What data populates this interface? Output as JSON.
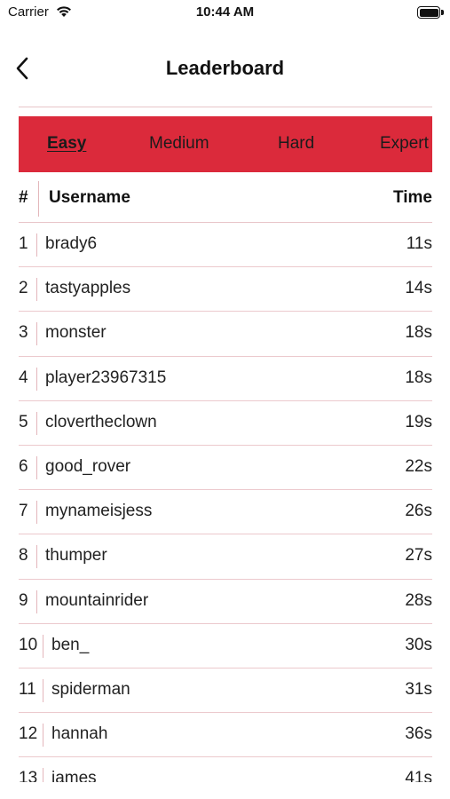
{
  "status_bar": {
    "carrier": "Carrier",
    "time": "10:44 AM"
  },
  "nav": {
    "title": "Leaderboard",
    "back_icon": "chevron-left-icon"
  },
  "tabs": [
    {
      "label": "Easy",
      "active": true
    },
    {
      "label": "Medium",
      "active": false
    },
    {
      "label": "Hard",
      "active": false
    },
    {
      "label": "Expert",
      "active": false
    }
  ],
  "colors": {
    "accent": "#db2a3b",
    "divider": "#e8c5c9"
  },
  "table": {
    "headers": {
      "rank": "#",
      "username": "Username",
      "time": "Time"
    },
    "rows": [
      {
        "rank": "1",
        "username": "brady6",
        "time": "11s"
      },
      {
        "rank": "2",
        "username": "tastyapples",
        "time": "14s"
      },
      {
        "rank": "3",
        "username": "monster",
        "time": "18s"
      },
      {
        "rank": "4",
        "username": "player23967315",
        "time": "18s"
      },
      {
        "rank": "5",
        "username": "clovertheclown",
        "time": "19s"
      },
      {
        "rank": "6",
        "username": "good_rover",
        "time": "22s"
      },
      {
        "rank": "7",
        "username": "mynameisjess",
        "time": "26s"
      },
      {
        "rank": "8",
        "username": "thumper",
        "time": "27s"
      },
      {
        "rank": "9",
        "username": "mountainrider",
        "time": "28s"
      },
      {
        "rank": "10",
        "username": "ben_",
        "time": "30s"
      },
      {
        "rank": "11",
        "username": "spiderman",
        "time": "31s"
      },
      {
        "rank": "12",
        "username": "hannah",
        "time": "36s"
      },
      {
        "rank": "13",
        "username": "james",
        "time": "41s"
      }
    ]
  }
}
